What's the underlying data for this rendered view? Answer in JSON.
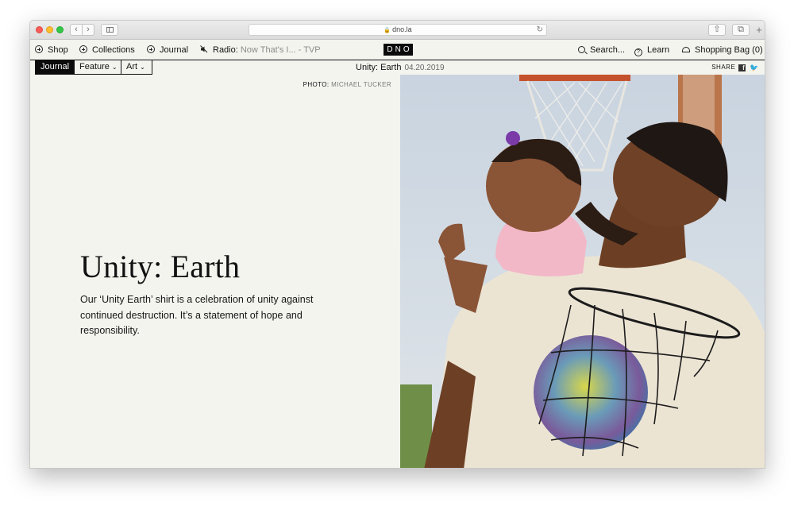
{
  "browser": {
    "url": "dno.la",
    "back_glyph": "‹",
    "forward_glyph": "›",
    "reload_glyph": "↻",
    "lock_glyph": "🔒",
    "share_glyph": "⇧",
    "tabs_glyph": "⧉",
    "newtab_glyph": "+"
  },
  "site_nav": {
    "shop": "Shop",
    "collections": "Collections",
    "journal": "Journal",
    "radio_label": "Radio:",
    "radio_now": "Now That's I... - TVP",
    "logo": "DNO",
    "search": "Search...",
    "learn": "Learn",
    "bag": "Shopping Bag (0)"
  },
  "subbar": {
    "tab_journal": "Journal",
    "tab_feature": "Feature",
    "tab_art": "Art",
    "chevron": "⌄",
    "article_title": "Unity: Earth",
    "article_date": "04.20.2019",
    "share_label": "SHARE",
    "fb": "f",
    "tw": "🐦"
  },
  "article": {
    "photo_label": "PHOTO:",
    "photo_credit": "MICHAEL TUCKER",
    "headline": "Unity: Earth",
    "dek": "Our ‘Unity Earth’ shirt is a celebration of unity against continued destruction. It’s a statement of hope and responsibility."
  },
  "colors": {
    "page_bg": "#f4f4ef",
    "accent_black": "#0b0b0b",
    "muted_text": "#8a8a8a"
  }
}
